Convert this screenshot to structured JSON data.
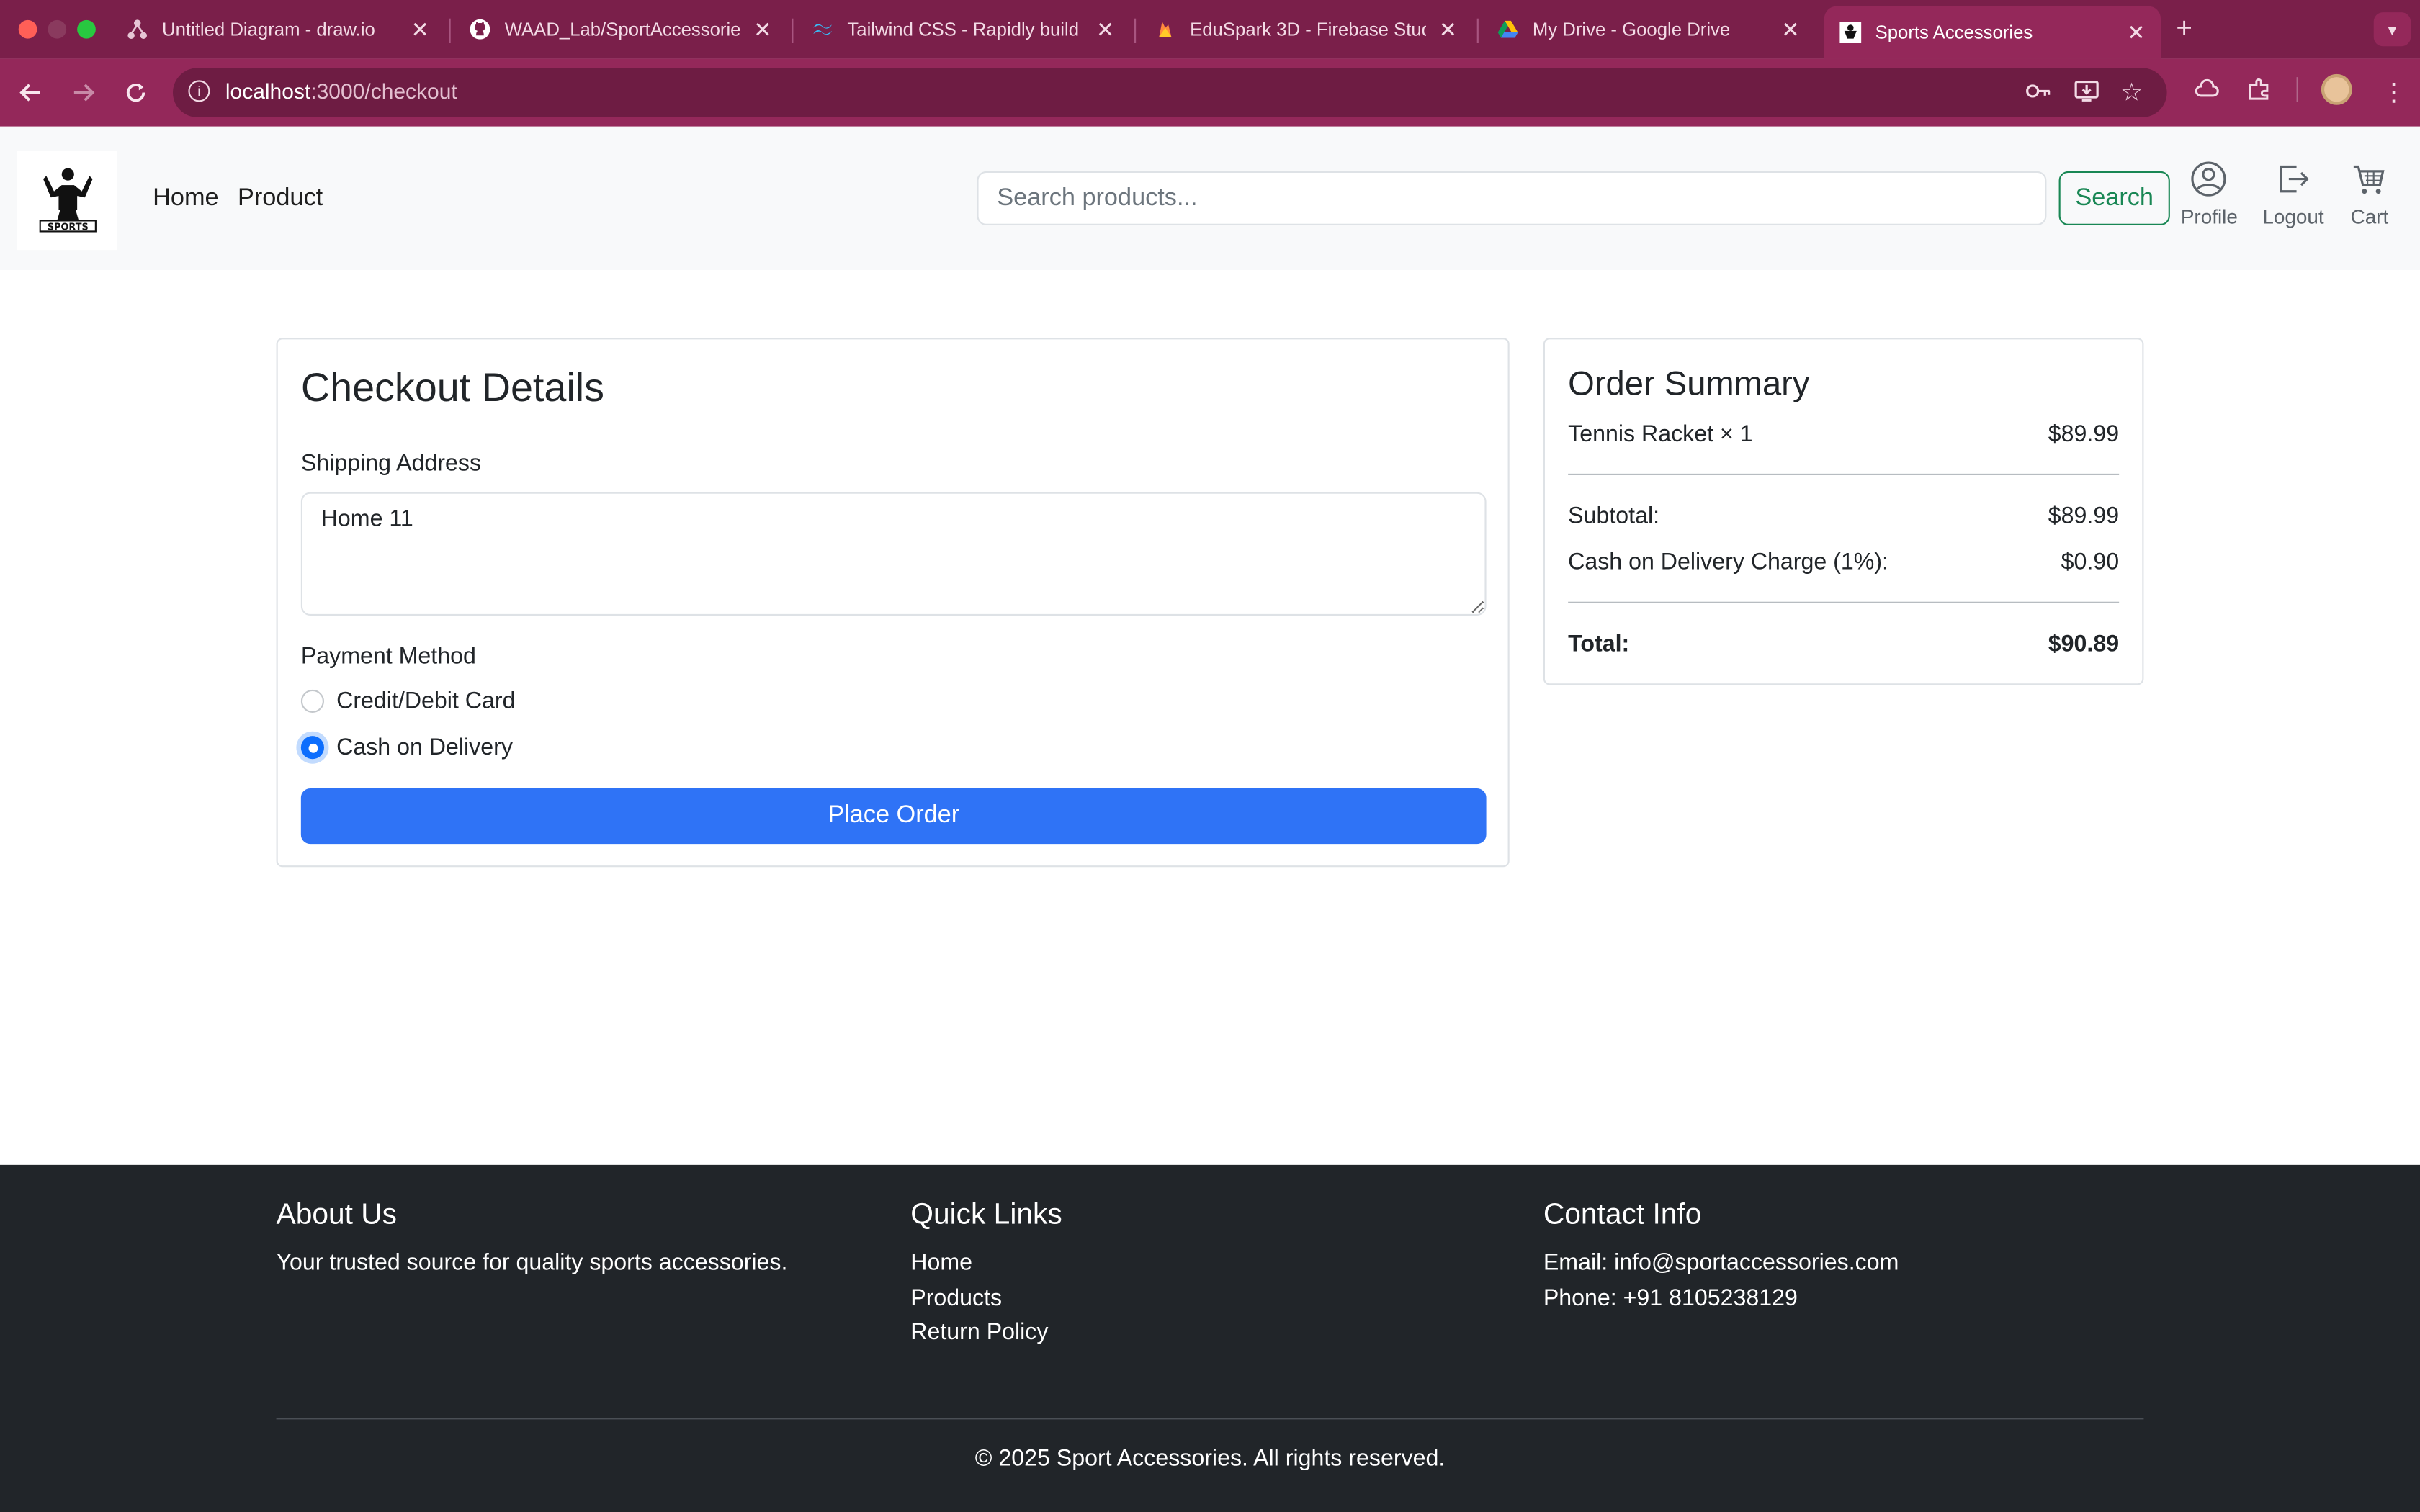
{
  "browser": {
    "tabs": [
      {
        "title": "Untitled Diagram - draw.io",
        "active": false
      },
      {
        "title": "WAAD_Lab/SportAccessories",
        "active": false
      },
      {
        "title": "Tailwind CSS - Rapidly build m",
        "active": false
      },
      {
        "title": "EduSpark 3D - Firebase Studi",
        "active": false
      },
      {
        "title": "My Drive - Google Drive",
        "active": false
      },
      {
        "title": "Sports Accessories",
        "active": true
      }
    ],
    "url_host": "localhost",
    "url_path": ":3000/checkout",
    "colors": {
      "tabstrip": "#7a1f4a",
      "toolbar": "#94285a"
    }
  },
  "site": {
    "nav": {
      "home": "Home",
      "product": "Product"
    },
    "search": {
      "placeholder": "Search products...",
      "button": "Search"
    },
    "icons": {
      "profile": "Profile",
      "logout": "Logout",
      "cart": "Cart"
    }
  },
  "checkout": {
    "title": "Checkout Details",
    "shipping_label": "Shipping Address",
    "shipping_value": "Home 11",
    "payment_label": "Payment Method",
    "payment_options": [
      "Credit/Debit Card",
      "Cash on Delivery"
    ],
    "selected_payment": "Cash on Delivery",
    "place_order": "Place Order"
  },
  "summary": {
    "title": "Order Summary",
    "item": {
      "name": "Tennis Racket × 1",
      "price": "$89.99"
    },
    "subtotal": {
      "label": "Subtotal:",
      "value": "$89.99"
    },
    "cod_charge": {
      "label": "Cash on Delivery Charge (1%):",
      "value": "$0.90"
    },
    "total": {
      "label": "Total:",
      "value": "$90.89"
    }
  },
  "footer": {
    "about": {
      "title": "About Us",
      "text": "Your trusted source for quality sports accessories."
    },
    "links": {
      "title": "Quick Links",
      "items": [
        "Home",
        "Products",
        "Return Policy"
      ]
    },
    "contact": {
      "title": "Contact Info",
      "email": "Email: info@sportaccessories.com",
      "phone": "Phone: +91 8105238129"
    },
    "copyright": "© 2025 Sport Accessories. All rights reserved."
  }
}
